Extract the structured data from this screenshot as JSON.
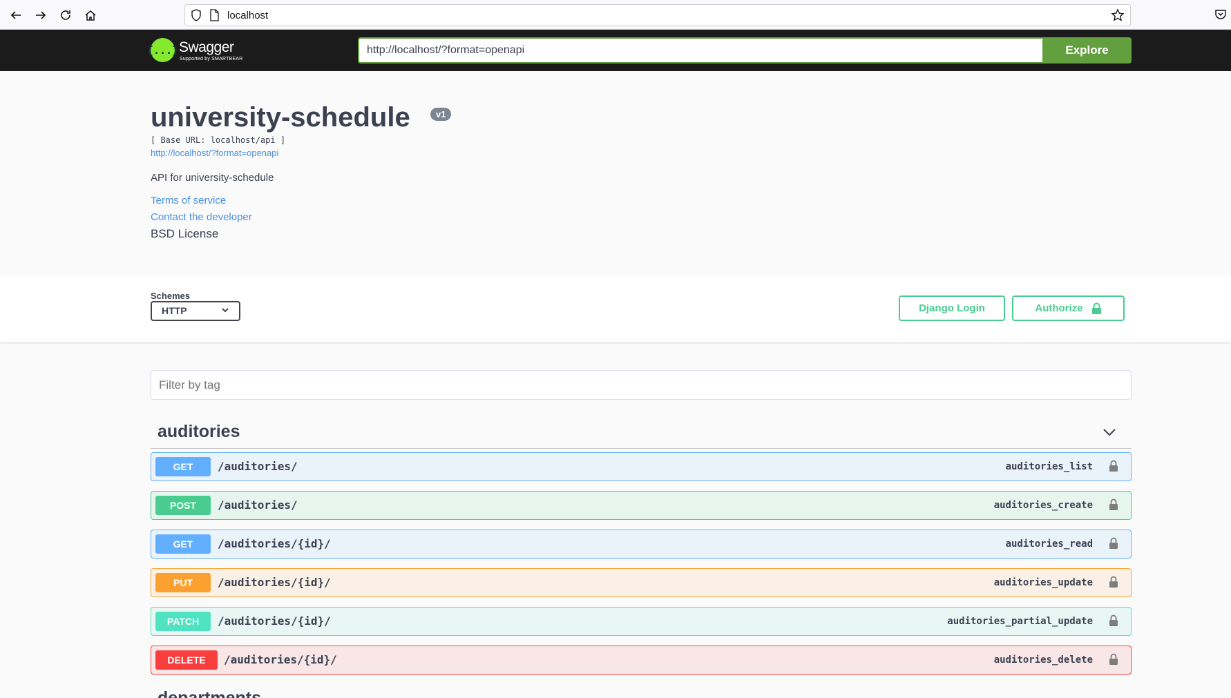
{
  "browser": {
    "url": "localhost"
  },
  "topbar": {
    "logo_name": "Swagger",
    "logo_sub": "Supported by SMARTBEAR",
    "logo_glyph": "{...}",
    "spec_url": "http://localhost/?format=openapi",
    "explore_label": "Explore"
  },
  "info": {
    "title": "university-schedule",
    "version": "v1",
    "base_url": "[ Base URL: localhost/api ]",
    "spec_link": "http://localhost/?format=openapi",
    "description": "API for university-schedule",
    "terms_of_service": "Terms of service",
    "contact": "Contact the developer",
    "license": "BSD License"
  },
  "schemes": {
    "label": "Schemes",
    "selected": "HTTP",
    "django_login_label": "Django Login",
    "authorize_label": "Authorize"
  },
  "filter": {
    "placeholder": "Filter by tag"
  },
  "tags": [
    {
      "name": "auditories",
      "operations": [
        {
          "method": "GET",
          "path": "/auditories/",
          "operation_id": "auditories_list"
        },
        {
          "method": "POST",
          "path": "/auditories/",
          "operation_id": "auditories_create"
        },
        {
          "method": "GET",
          "path": "/auditories/{id}/",
          "operation_id": "auditories_read"
        },
        {
          "method": "PUT",
          "path": "/auditories/{id}/",
          "operation_id": "auditories_update"
        },
        {
          "method": "PATCH",
          "path": "/auditories/{id}/",
          "operation_id": "auditories_partial_update"
        },
        {
          "method": "DELETE",
          "path": "/auditories/{id}/",
          "operation_id": "auditories_delete"
        }
      ]
    },
    {
      "name": "departments"
    }
  ],
  "colors": {
    "get": "#61affe",
    "post": "#49cc90",
    "put": "#fca130",
    "patch": "#50e3c2",
    "delete": "#f93e3e",
    "explore": "#62a03f",
    "topbar": "#1b1b1b"
  }
}
